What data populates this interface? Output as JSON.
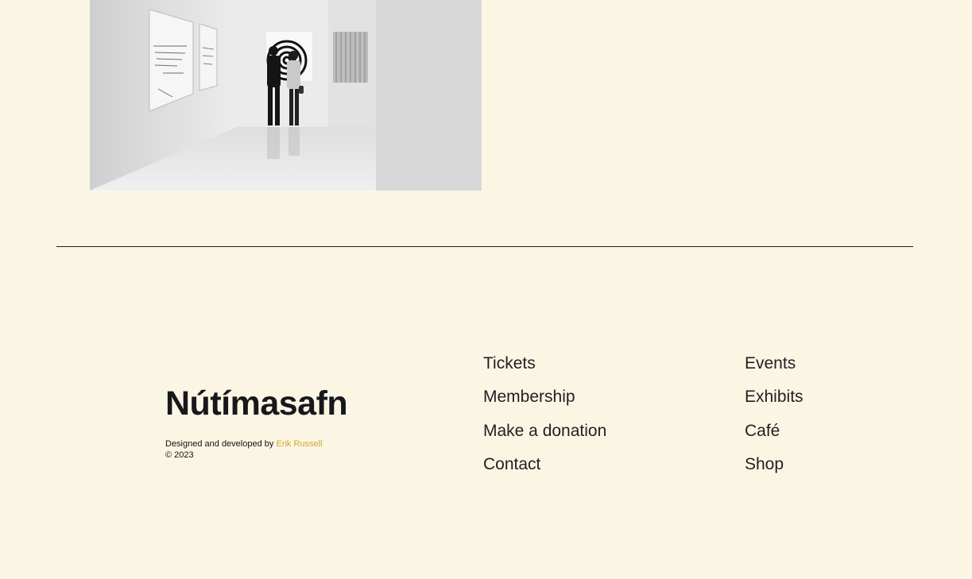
{
  "footer": {
    "brand": "Nútímasafn",
    "credit_prefix": "Designed and developed by",
    "credit_author": "Erik Russell",
    "copyright": "© 2023"
  },
  "nav_primary": [
    {
      "label": "Tickets"
    },
    {
      "label": "Membership"
    },
    {
      "label": "Make a donation"
    },
    {
      "label": "Contact"
    }
  ],
  "nav_secondary": [
    {
      "label": "Events"
    },
    {
      "label": "Exhibits"
    },
    {
      "label": "Café"
    },
    {
      "label": "Shop"
    }
  ],
  "colors": {
    "background": "#fbf6e4",
    "text": "#1c1c1e",
    "accent": "#d4a52a"
  }
}
